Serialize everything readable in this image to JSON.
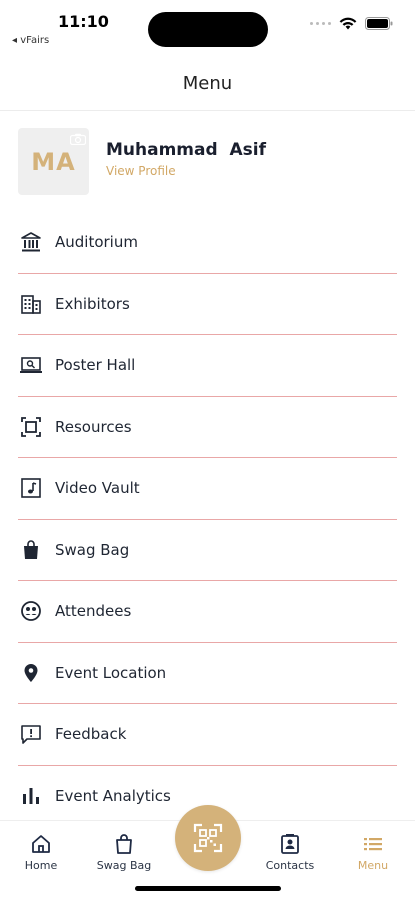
{
  "status_bar": {
    "time": "11:10",
    "back_label": "◂ vFairs"
  },
  "header": {
    "title": "Menu"
  },
  "profile": {
    "initials": "MA",
    "name": "Muhammad  Asif",
    "view_profile": "View Profile"
  },
  "menu": {
    "items": [
      {
        "label": "Auditorium",
        "icon": "auditorium-icon"
      },
      {
        "label": "Exhibitors",
        "icon": "exhibitors-icon"
      },
      {
        "label": "Poster Hall",
        "icon": "poster-hall-icon"
      },
      {
        "label": "Resources",
        "icon": "resources-icon"
      },
      {
        "label": "Video Vault",
        "icon": "video-vault-icon"
      },
      {
        "label": "Swag Bag",
        "icon": "swag-bag-icon"
      },
      {
        "label": "Attendees",
        "icon": "attendees-icon"
      },
      {
        "label": "Event Location",
        "icon": "location-pin-icon"
      },
      {
        "label": "Feedback",
        "icon": "feedback-icon"
      },
      {
        "label": "Event Analytics",
        "icon": "analytics-icon"
      }
    ]
  },
  "bottom_nav": {
    "home": "Home",
    "swag_bag": "Swag Bag",
    "contacts": "Contacts",
    "menu": "Menu"
  },
  "colors": {
    "accent": "#d2a866",
    "divider": "#e9a7a7",
    "text": "#1f2633"
  }
}
